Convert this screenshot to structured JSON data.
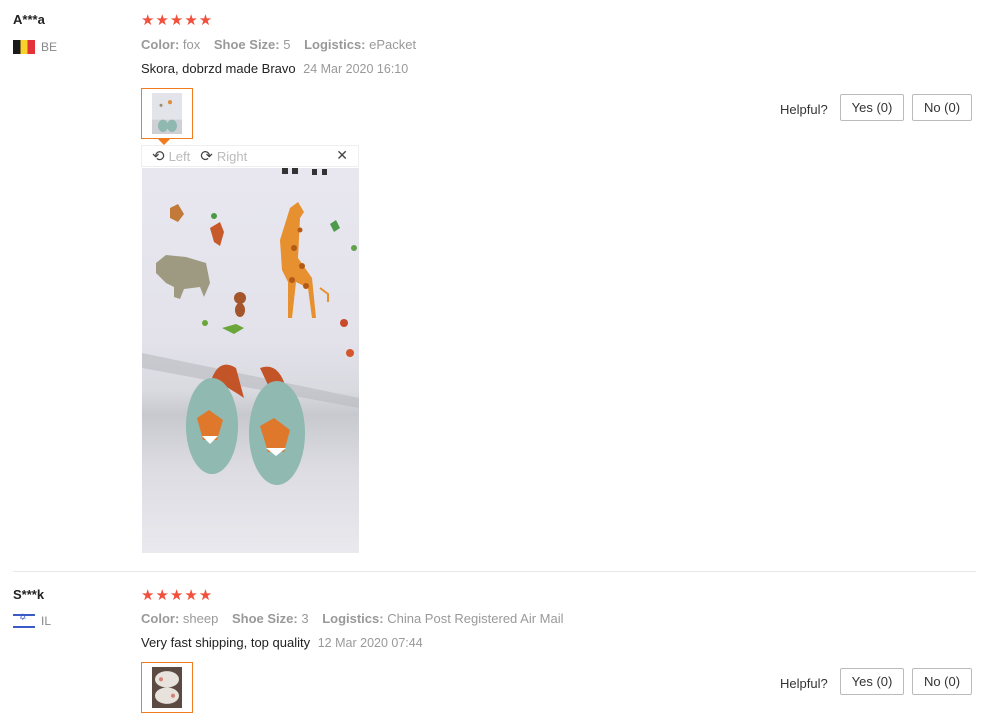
{
  "reviews": [
    {
      "user": "A***a",
      "country": "BE",
      "rating": 5,
      "stars": "★★★★★",
      "props": [
        {
          "key": "Color:",
          "value": "fox"
        },
        {
          "key": "Shoe Size:",
          "value": "5"
        },
        {
          "key": "Logistics:",
          "value": "ePacket"
        }
      ],
      "text": "Skora, dobrzd made Bravo",
      "date": "24 Mar 2020 16:10",
      "helpful_label": "Helpful?",
      "yes_label": "Yes (0)",
      "no_label": "No (0)"
    },
    {
      "user": "S***k",
      "country": "IL",
      "rating": 5,
      "stars": "★★★★★",
      "props": [
        {
          "key": "Color:",
          "value": "sheep"
        },
        {
          "key": "Shoe Size:",
          "value": "3"
        },
        {
          "key": "Logistics:",
          "value": "China Post Registered Air Mail"
        }
      ],
      "text": "Very fast shipping, top quality",
      "date": "12 Mar 2020 07:44",
      "helpful_label": "Helpful?",
      "yes_label": "Yes (0)",
      "no_label": "No (0)"
    }
  ],
  "viewer": {
    "left_label": "Left",
    "right_label": "Right",
    "rotate_left_icon": "rotate-left-icon",
    "rotate_right_icon": "rotate-right-icon",
    "close_icon": "close-icon"
  },
  "colors": {
    "star": "#f0503c",
    "thumb_border": "#f17c1f"
  }
}
